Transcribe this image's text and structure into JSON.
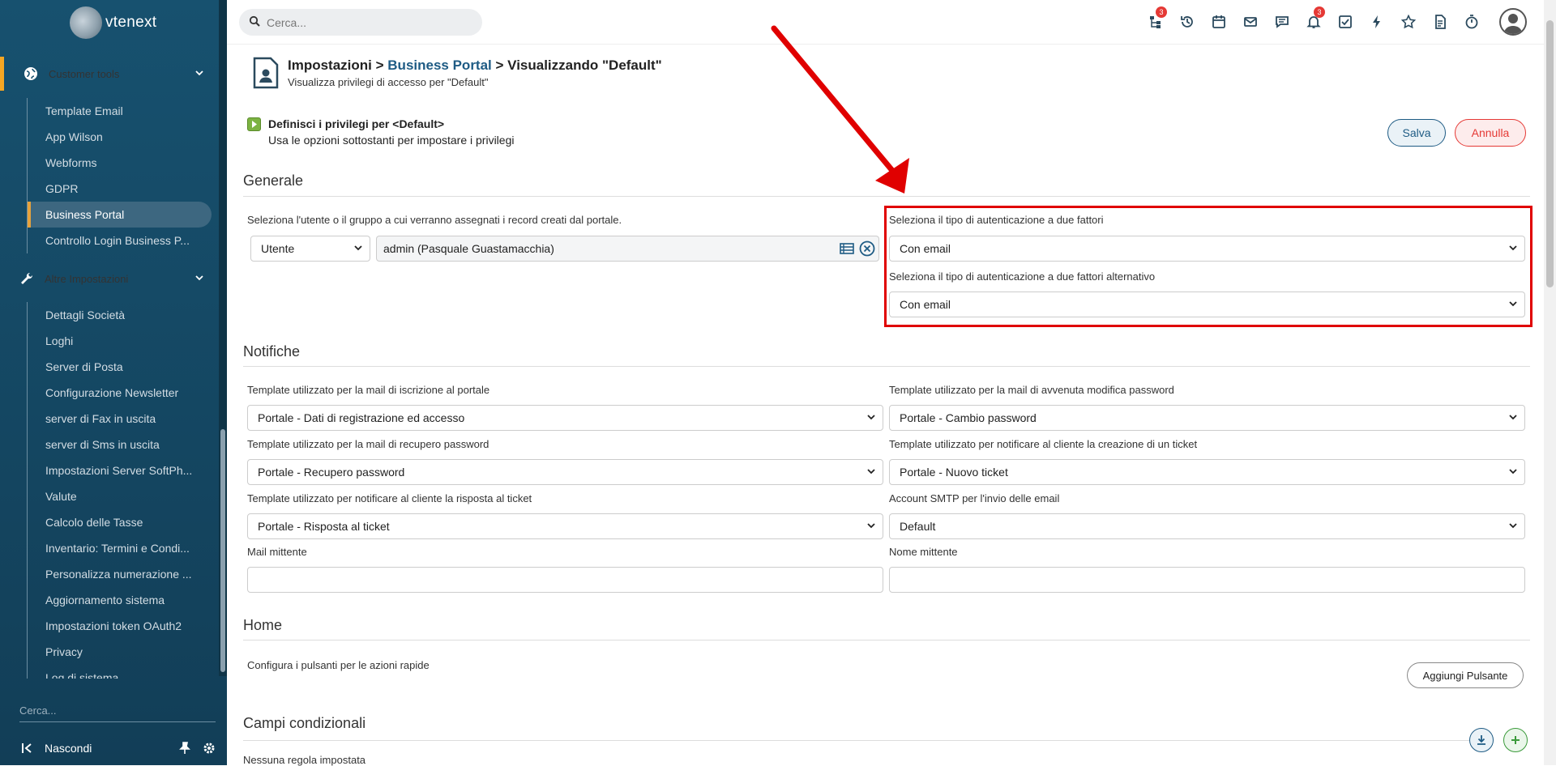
{
  "app": {
    "name": "vtenext"
  },
  "sidebar": {
    "section_customer": "Customer tools",
    "customer_items": [
      "Template Email",
      "App Wilson",
      "Webforms",
      "GDPR",
      "Business Portal",
      "Controllo Login Business P..."
    ],
    "section_other": "Altre Impostazioni",
    "other_items": [
      "Dettagli Società",
      "Loghi",
      "Server di Posta",
      "Configurazione Newsletter",
      "server di Fax in uscita",
      "server di Sms in uscita",
      "Impostazioni Server SoftPh...",
      "Valute",
      "Calcolo delle Tasse",
      "Inventario: Termini e Condi...",
      "Personalizza numerazione ...",
      "Aggiornamento sistema",
      "Impostazioni token OAuth2",
      "Privacy",
      "Log di sistema"
    ],
    "search_placeholder": "Cerca...",
    "hide_label": "Nascondi"
  },
  "topbar": {
    "search_placeholder": "Cerca...",
    "icons": [
      "org-chart-icon",
      "history-icon",
      "calendar-icon",
      "mail-icon",
      "chat-icon",
      "bell-icon",
      "task-icon",
      "bolt-icon",
      "star-icon",
      "document-icon",
      "timer-icon"
    ],
    "badges": {
      "org_chart": "3",
      "bell": "3"
    }
  },
  "header": {
    "crumb_root": "Impostazioni",
    "sep1": " > ",
    "crumb_link": "Business Portal",
    "sep2": " > ",
    "crumb_current": "Visualizzando \"Default\"",
    "subtitle": "Visualizza privilegi di accesso per \"Default\""
  },
  "privileges": {
    "title": "Definisci i privilegi per <Default>",
    "subtitle": "Usa le opzioni sottostanti per impostare i privilegi"
  },
  "actions": {
    "save": "Salva",
    "cancel": "Annulla"
  },
  "generale": {
    "title": "Generale",
    "user_label": "Seleziona l'utente o il gruppo a cui verranno assegnati i record creati dal portale.",
    "user_type": "Utente",
    "user_value": "admin (Pasquale Guastamacchia)",
    "twofa_label": "Seleziona il tipo di autenticazione a due fattori",
    "twofa_value": "Con email",
    "twofa_alt_label": "Seleziona il tipo di autenticazione a due fattori alternativo",
    "twofa_alt_value": "Con email"
  },
  "notifiche": {
    "title": "Notifiche",
    "reg_label": "Template utilizzato per la mail di iscrizione al portale",
    "reg_value": "Portale - Dati di registrazione ed accesso",
    "pwchange_label": "Template utilizzato per la mail di avvenuta modifica password",
    "pwchange_value": "Portale - Cambio password",
    "recover_label": "Template utilizzato per la mail di recupero password",
    "recover_value": "Portale - Recupero password",
    "ticket_label": "Template utilizzato per notificare al cliente la creazione di un ticket",
    "ticket_value": "Portale - Nuovo ticket",
    "reply_label": "Template utilizzato per notificare al cliente la risposta al ticket",
    "reply_value": "Portale - Risposta al ticket",
    "smtp_label": "Account SMTP per l'invio delle email",
    "smtp_value": "Default",
    "sender_mail_label": "Mail mittente",
    "sender_name_label": "Nome mittente"
  },
  "home": {
    "title": "Home",
    "desc": "Configura i pulsanti per le azioni rapide",
    "add_button": "Aggiungi Pulsante"
  },
  "conditional": {
    "title": "Campi condizionali",
    "empty": "Nessuna regola impostata"
  },
  "colors": {
    "sidebar": "#17516f",
    "accent": "#1e5b84",
    "danger": "#e53935",
    "highlight": "#e00000"
  }
}
